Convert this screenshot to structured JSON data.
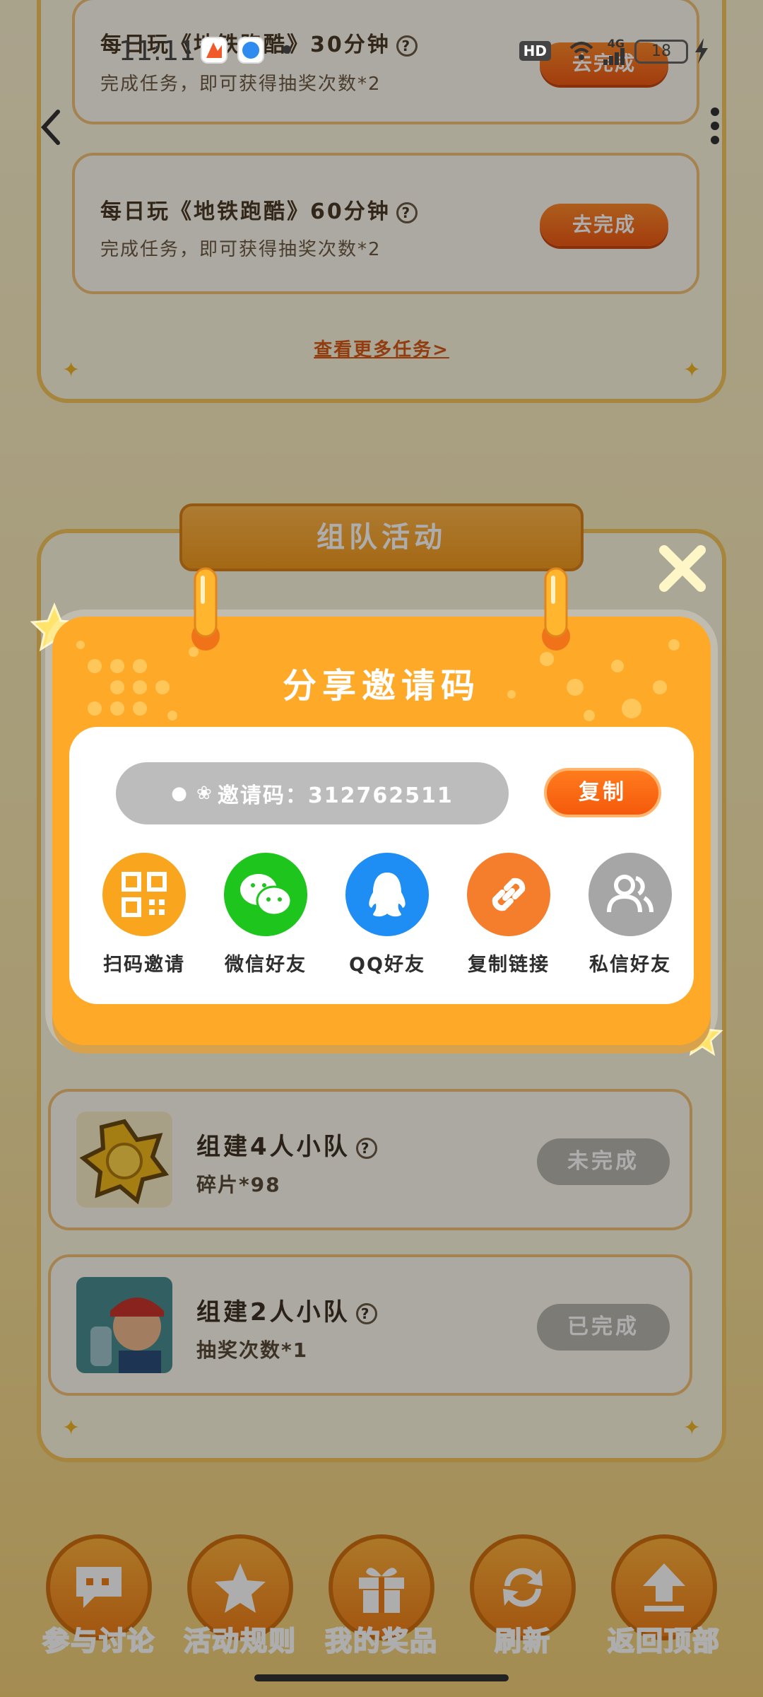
{
  "status_bar": {
    "time": "11:11",
    "hd": "HD",
    "network": "4G",
    "battery": "18"
  },
  "tasks": [
    {
      "title": "每日玩《地铁跑酷》30分钟",
      "subtitle": "完成任务，即可获得抽奖次数*2",
      "button": "去完成"
    },
    {
      "title": "每日玩《地铁跑酷》60分钟",
      "subtitle": "完成任务，即可获得抽奖次数*2",
      "button": "去完成"
    }
  ],
  "more_tasks_link": "查看更多任务>",
  "team_section": {
    "banner": "组队活动",
    "rows": [
      {
        "title": "组建4人小队",
        "reward": "碎片*98",
        "button": "未完成"
      },
      {
        "title": "组建2人小队",
        "reward": "抽奖次数*1",
        "button": "已完成"
      }
    ]
  },
  "modal": {
    "title": "分享邀请码",
    "invite_label": "邀请码：312762511",
    "copy_button": "复制",
    "share_options": [
      {
        "label": "扫码邀请",
        "icon": "qr-code-icon",
        "color": "#f9a51e"
      },
      {
        "label": "微信好友",
        "icon": "wechat-icon",
        "color": "#1ec51c"
      },
      {
        "label": "QQ好友",
        "icon": "qq-penguin-icon",
        "color": "#1e8ef5"
      },
      {
        "label": "复制链接",
        "icon": "link-icon",
        "color": "#f57e2c"
      },
      {
        "label": "私信好友",
        "icon": "users-icon",
        "color": "#a6a6a6"
      }
    ]
  },
  "bottom_nav": [
    {
      "label": "参与讨论",
      "icon": "chat-icon"
    },
    {
      "label": "活动规则",
      "icon": "rules-star-icon"
    },
    {
      "label": "我的奖品",
      "icon": "gift-icon"
    },
    {
      "label": "刷新",
      "icon": "refresh-icon"
    },
    {
      "label": "返回顶部",
      "icon": "back-to-top-icon"
    }
  ],
  "colors": {
    "accent_orange": "#ffa928",
    "button_orange": "#f55a0c",
    "panel_border": "#f5c65c"
  }
}
